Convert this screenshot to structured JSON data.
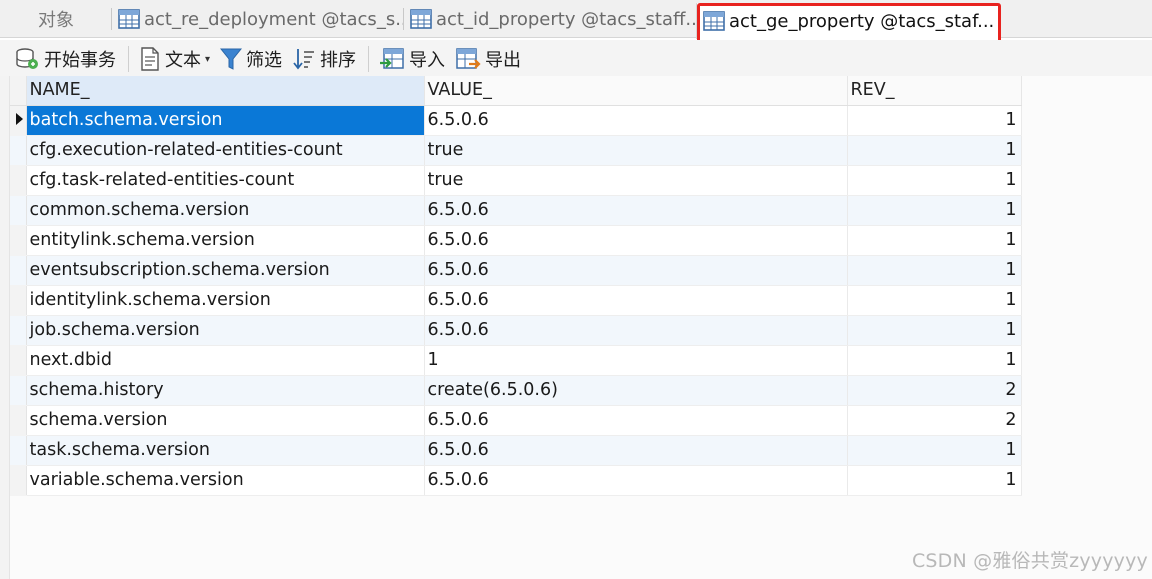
{
  "tabs": [
    {
      "label": "对象",
      "kind": "objects"
    },
    {
      "label": "act_re_deployment @tacs_s...",
      "kind": "table"
    },
    {
      "label": "act_id_property @tacs_staff...",
      "kind": "table"
    },
    {
      "label": "act_ge_property @tacs_staf...",
      "kind": "table",
      "active": true
    }
  ],
  "highlight_color": "#e8231f",
  "toolbar": {
    "begin_transaction": "开始事务",
    "text": "文本",
    "filter": "筛选",
    "sort": "排序",
    "import": "导入",
    "export": "导出"
  },
  "grid": {
    "columns": [
      "NAME_",
      "VALUE_",
      "REV_"
    ],
    "sorted_column": "NAME_",
    "selected_row": 0,
    "rows": [
      {
        "name": "batch.schema.version",
        "value": "6.5.0.6",
        "rev": "1"
      },
      {
        "name": "cfg.execution-related-entities-count",
        "value": "true",
        "rev": "1"
      },
      {
        "name": "cfg.task-related-entities-count",
        "value": "true",
        "rev": "1"
      },
      {
        "name": "common.schema.version",
        "value": "6.5.0.6",
        "rev": "1"
      },
      {
        "name": "entitylink.schema.version",
        "value": "6.5.0.6",
        "rev": "1"
      },
      {
        "name": "eventsubscription.schema.version",
        "value": "6.5.0.6",
        "rev": "1"
      },
      {
        "name": "identitylink.schema.version",
        "value": "6.5.0.6",
        "rev": "1"
      },
      {
        "name": "job.schema.version",
        "value": "6.5.0.6",
        "rev": "1"
      },
      {
        "name": "next.dbid",
        "value": "1",
        "rev": "1"
      },
      {
        "name": "schema.history",
        "value": "create(6.5.0.6)",
        "rev": "2"
      },
      {
        "name": "schema.version",
        "value": "6.5.0.6",
        "rev": "2"
      },
      {
        "name": "task.schema.version",
        "value": "6.5.0.6",
        "rev": "1"
      },
      {
        "name": "variable.schema.version",
        "value": "6.5.0.6",
        "rev": "1"
      }
    ]
  },
  "watermark": "CSDN @雅俗共赏zyyyyyy"
}
